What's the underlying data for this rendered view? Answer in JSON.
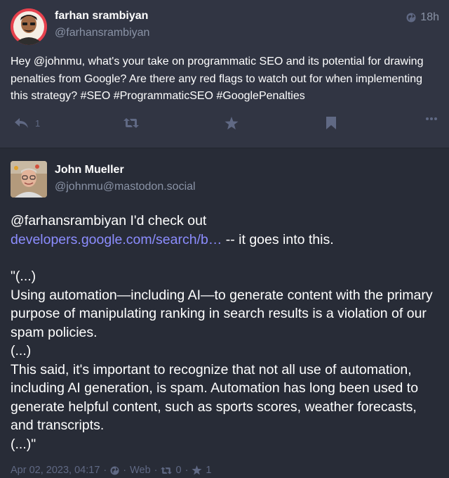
{
  "post1": {
    "author_name": "farhan srambiyan",
    "author_handle": "@farhansrambiyan",
    "time": "18h",
    "text": "Hey @johnmu, what's your take on programmatic SEO and its potential for drawing penalties from Google? Are there any red flags to watch out for when implementing this strategy? #SEO #ProgrammaticSEO #GooglePenalties",
    "reply_count": "1",
    "icons": {
      "globe": "globe-icon",
      "reply": "reply-icon",
      "boost": "boost-icon",
      "favourite": "star-icon",
      "bookmark": "bookmark-icon",
      "more": "more-icon"
    }
  },
  "post2": {
    "author_name": "John Mueller",
    "author_handle": "@johnmu@mastodon.social",
    "mention": "@farhansrambiyan",
    "text_intro_after_mention": " I'd check out",
    "link": "developers.google.com/search/b…",
    "text_after_link": " -- it goes into this.",
    "quote_open": "\"(...)",
    "quote_p1": "Using automation—including AI—to generate content with the primary purpose of manipulating ranking in search results is a violation of our spam policies.",
    "quote_ellipsis": "(...)",
    "quote_p2": "This said, it's important to recognize that not all use of automation, including AI generation, is spam. Automation has long been used to generate helpful content, such as sports scores, weather forecasts, and transcripts.",
    "quote_close": "(...)\"",
    "meta": {
      "date": "Apr 02, 2023, 04:17",
      "dot": "·",
      "app": "Web",
      "boosts": "0",
      "favs": "1"
    }
  },
  "colors": {
    "background": "#282c37",
    "card": "#313543",
    "link": "#8c8dff",
    "muted": "#606984",
    "text": "#ffffff"
  }
}
